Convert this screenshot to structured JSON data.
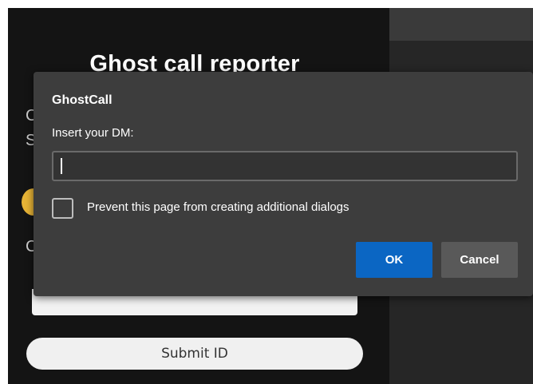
{
  "app": {
    "title": "Ghost call reporter",
    "fragments": [
      "C",
      "S",
      "C"
    ],
    "submit_label": "Submit ID"
  },
  "dialog": {
    "title": "GhostCall",
    "message": "Insert your DM:",
    "input_value": "",
    "checkbox_label": "Prevent this page from creating additional dialogs",
    "checkbox_checked": false,
    "ok_label": "OK",
    "cancel_label": "Cancel"
  },
  "colors": {
    "ok_button": "#0b66c3",
    "cancel_button": "#595959",
    "dialog_bg": "#3d3d3d",
    "app_bg": "#141414",
    "accent_dot": "#e8b436"
  }
}
